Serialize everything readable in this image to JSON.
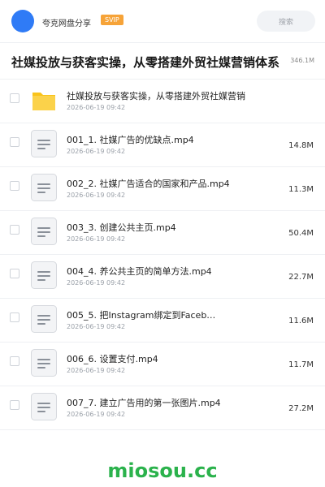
{
  "header": {
    "user_name": "夸克网盘分享",
    "badge": "SVIP",
    "search_placeholder": "搜索"
  },
  "share": {
    "title": "社媒投放与获客实操，从零搭建外贸社媒营销体系",
    "total_size": "346.1M"
  },
  "files": [
    {
      "type": "folder",
      "name": "社媒投放与获客实操，从零搭建外贸社媒营销体系",
      "date": "2026-06-19 09:42",
      "size": ""
    },
    {
      "type": "video",
      "name": "001_1. 社媒广告的优缺点.mp4",
      "date": "2026-06-19 09:42",
      "size": "14.8M"
    },
    {
      "type": "video",
      "name": "002_2. 社媒广告适合的国家和产品.mp4",
      "date": "2026-06-19 09:42",
      "size": "11.3M"
    },
    {
      "type": "video",
      "name": "003_3. 创建公共主页.mp4",
      "date": "2026-06-19 09:42",
      "size": "50.4M"
    },
    {
      "type": "video",
      "name": "004_4. 养公共主页的简单方法.mp4",
      "date": "2026-06-19 09:42",
      "size": "22.7M"
    },
    {
      "type": "video",
      "name": "005_5. 把Instagram绑定到Faceb…",
      "date": "2026-06-19 09:42",
      "size": "11.6M"
    },
    {
      "type": "video",
      "name": "006_6. 设置支付.mp4",
      "date": "2026-06-19 09:42",
      "size": "11.7M"
    },
    {
      "type": "video",
      "name": "007_7. 建立广告用的第一张图片.mp4",
      "date": "2026-06-19 09:42",
      "size": "27.2M"
    }
  ],
  "watermark": "miosou.cc",
  "colors": {
    "avatar": "#2f7bf6",
    "badge": "#f6a338",
    "folder": "#f9c31a",
    "watermark": "#2bb24c"
  }
}
